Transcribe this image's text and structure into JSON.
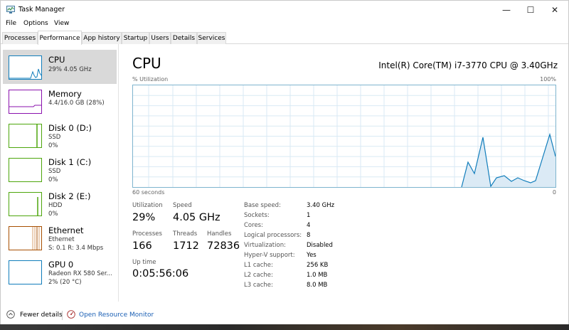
{
  "window": {
    "title": "Task Manager",
    "min": "—",
    "max": "☐",
    "close": "✕"
  },
  "menu": [
    "File",
    "Options",
    "View"
  ],
  "tabs": [
    "Processes",
    "Performance",
    "App history",
    "Startup",
    "Users",
    "Details",
    "Services"
  ],
  "active_tab": "Performance",
  "sidebar": [
    {
      "name": "CPU",
      "lines": [
        "29%  4.05 GHz"
      ],
      "color": "#117dbb"
    },
    {
      "name": "Memory",
      "lines": [
        "4.4/16.0 GB (28%)"
      ],
      "color": "#8b12ae"
    },
    {
      "name": "Disk 0 (D:)",
      "lines": [
        "SSD",
        "0%"
      ],
      "color": "#4da60c"
    },
    {
      "name": "Disk 1 (C:)",
      "lines": [
        "SSD",
        "0%"
      ],
      "color": "#4da60c"
    },
    {
      "name": "Disk 2 (E:)",
      "lines": [
        "HDD",
        "0%"
      ],
      "color": "#4da60c"
    },
    {
      "name": "Ethernet",
      "lines": [
        "Ethernet",
        "S: 0.1  R: 3.4 Mbps"
      ],
      "color": "#a74f01"
    },
    {
      "name": "GPU 0",
      "lines": [
        "Radeon RX 580 Ser...",
        "2%  (20 °C)"
      ],
      "color": "#117dbb"
    }
  ],
  "main": {
    "title": "CPU",
    "processor": "Intel(R) Core(TM) i7-3770 CPU @ 3.40GHz",
    "graph_label": "% Utilization",
    "graph_max": "100%",
    "graph_time": "60 seconds",
    "graph_min": "0",
    "stats": {
      "utilization_label": "Utilization",
      "utilization": "29%",
      "speed_label": "Speed",
      "speed": "4.05 GHz",
      "processes_label": "Processes",
      "processes": "166",
      "threads_label": "Threads",
      "threads": "1712",
      "handles_label": "Handles",
      "handles": "72836",
      "uptime_label": "Up time",
      "uptime": "0:05:56:06"
    },
    "details": [
      {
        "key": "Base speed:",
        "value": "3.40 GHz"
      },
      {
        "key": "Sockets:",
        "value": "1"
      },
      {
        "key": "Cores:",
        "value": "4"
      },
      {
        "key": "Logical processors:",
        "value": "8"
      },
      {
        "key": "Virtualization:",
        "value": "Disabled"
      },
      {
        "key": "Hyper-V support:",
        "value": "Yes"
      },
      {
        "key": "L1 cache:",
        "value": "256 KB"
      },
      {
        "key": "L2 cache:",
        "value": "1.0 MB"
      },
      {
        "key": "L3 cache:",
        "value": "8.0 MB"
      }
    ]
  },
  "footer": {
    "fewer": "Fewer details",
    "monitor": "Open Resource Monitor"
  },
  "colors": {
    "cpu_line": "#117dbb",
    "grid": "#d9eaf4",
    "link": "#1a5fb4"
  }
}
